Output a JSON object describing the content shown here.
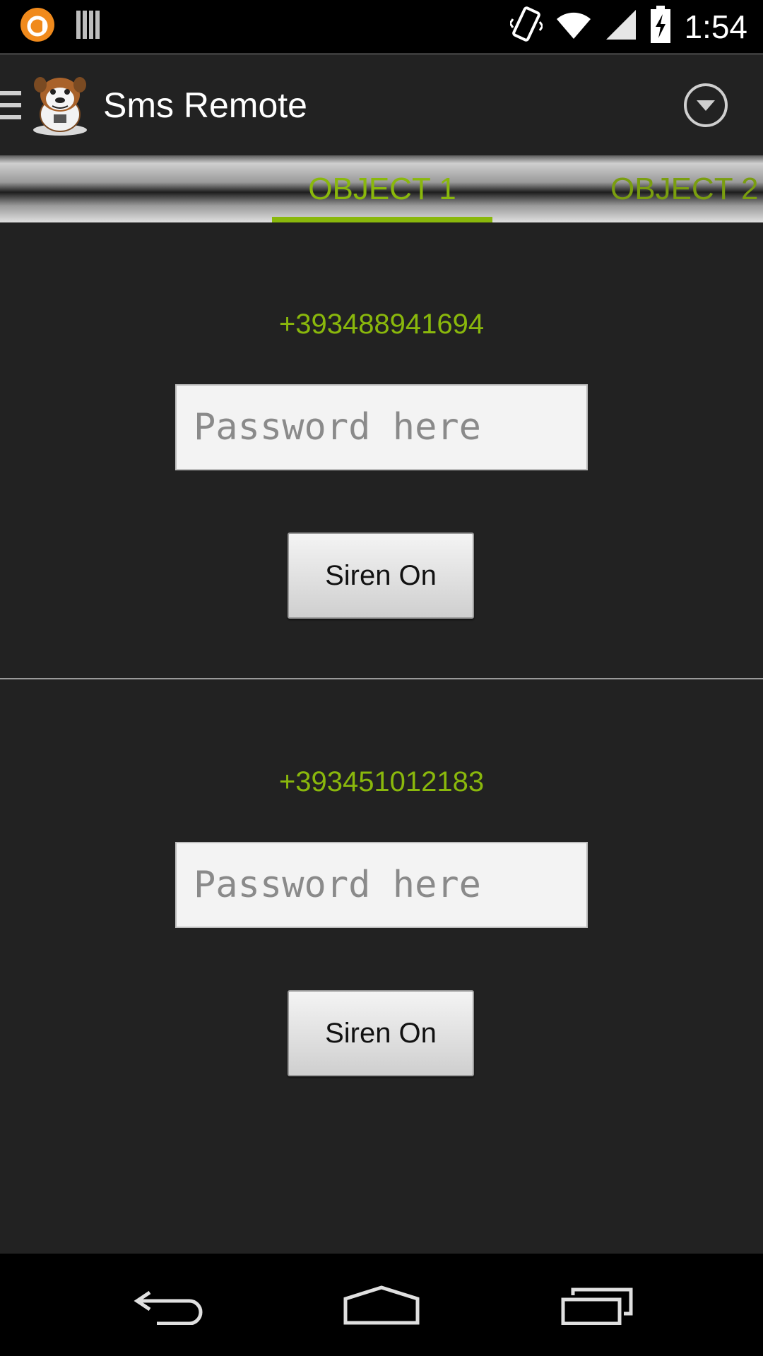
{
  "status_bar": {
    "time": "1:54",
    "icons": [
      "avast-icon",
      "barcode-icon",
      "vibrate-icon",
      "wifi-icon",
      "signal-icon",
      "battery-charging-icon"
    ]
  },
  "action_bar": {
    "title": "Sms Remote",
    "icons": [
      "drawer-icon",
      "bulldog-logo",
      "dropdown-icon"
    ]
  },
  "tabs": [
    {
      "label": "OBJECT 1",
      "selected": true
    },
    {
      "label": "OBJECT 2",
      "selected": false
    }
  ],
  "entries": [
    {
      "phone": "+393488941694",
      "password_placeholder": "Password here",
      "button_label": "Siren On"
    },
    {
      "phone": "+393451012183",
      "password_placeholder": "Password here",
      "button_label": "Siren On"
    }
  ],
  "nav_bar": {
    "icons": [
      "back-icon",
      "home-icon",
      "recents-icon"
    ]
  },
  "colors": {
    "accent": "#8ab80c",
    "background": "#222222",
    "status_bar": "#000000"
  }
}
